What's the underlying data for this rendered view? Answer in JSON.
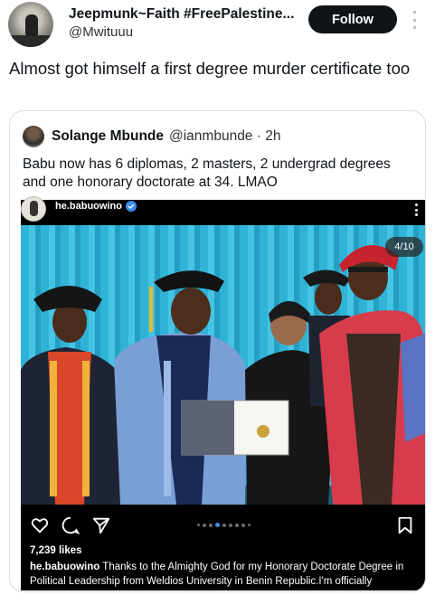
{
  "tweet": {
    "display_name": "Jeepmunk~Faith #FreePalestine...",
    "handle": "@Mwituuu",
    "follow_label": "Follow",
    "text": "Almost got himself a first degree murder certificate too"
  },
  "quoted_tweet": {
    "display_name": "Solange Mbunde",
    "handle_time": "@ianmbunde · 2h",
    "text": "Babu now has 6 diplomas, 2 masters, 2 undergrad degrees and one honorary doctorate at 34. LMAO"
  },
  "instagram": {
    "username": "he.babuowino",
    "counter": "4/10",
    "likes": "7,239 likes",
    "caption_user": "he.babuowino",
    "caption_text": " Thanks to the Almighty God for my Honorary Doctorate Degree in Political Leadership from Weldios University in Benin Republic.I'm officially DR.BABU OWINO.",
    "icons": [
      "heart-icon",
      "comment-icon",
      "share-icon",
      "bookmark-icon"
    ],
    "verified_color": "#3c8ef3"
  }
}
